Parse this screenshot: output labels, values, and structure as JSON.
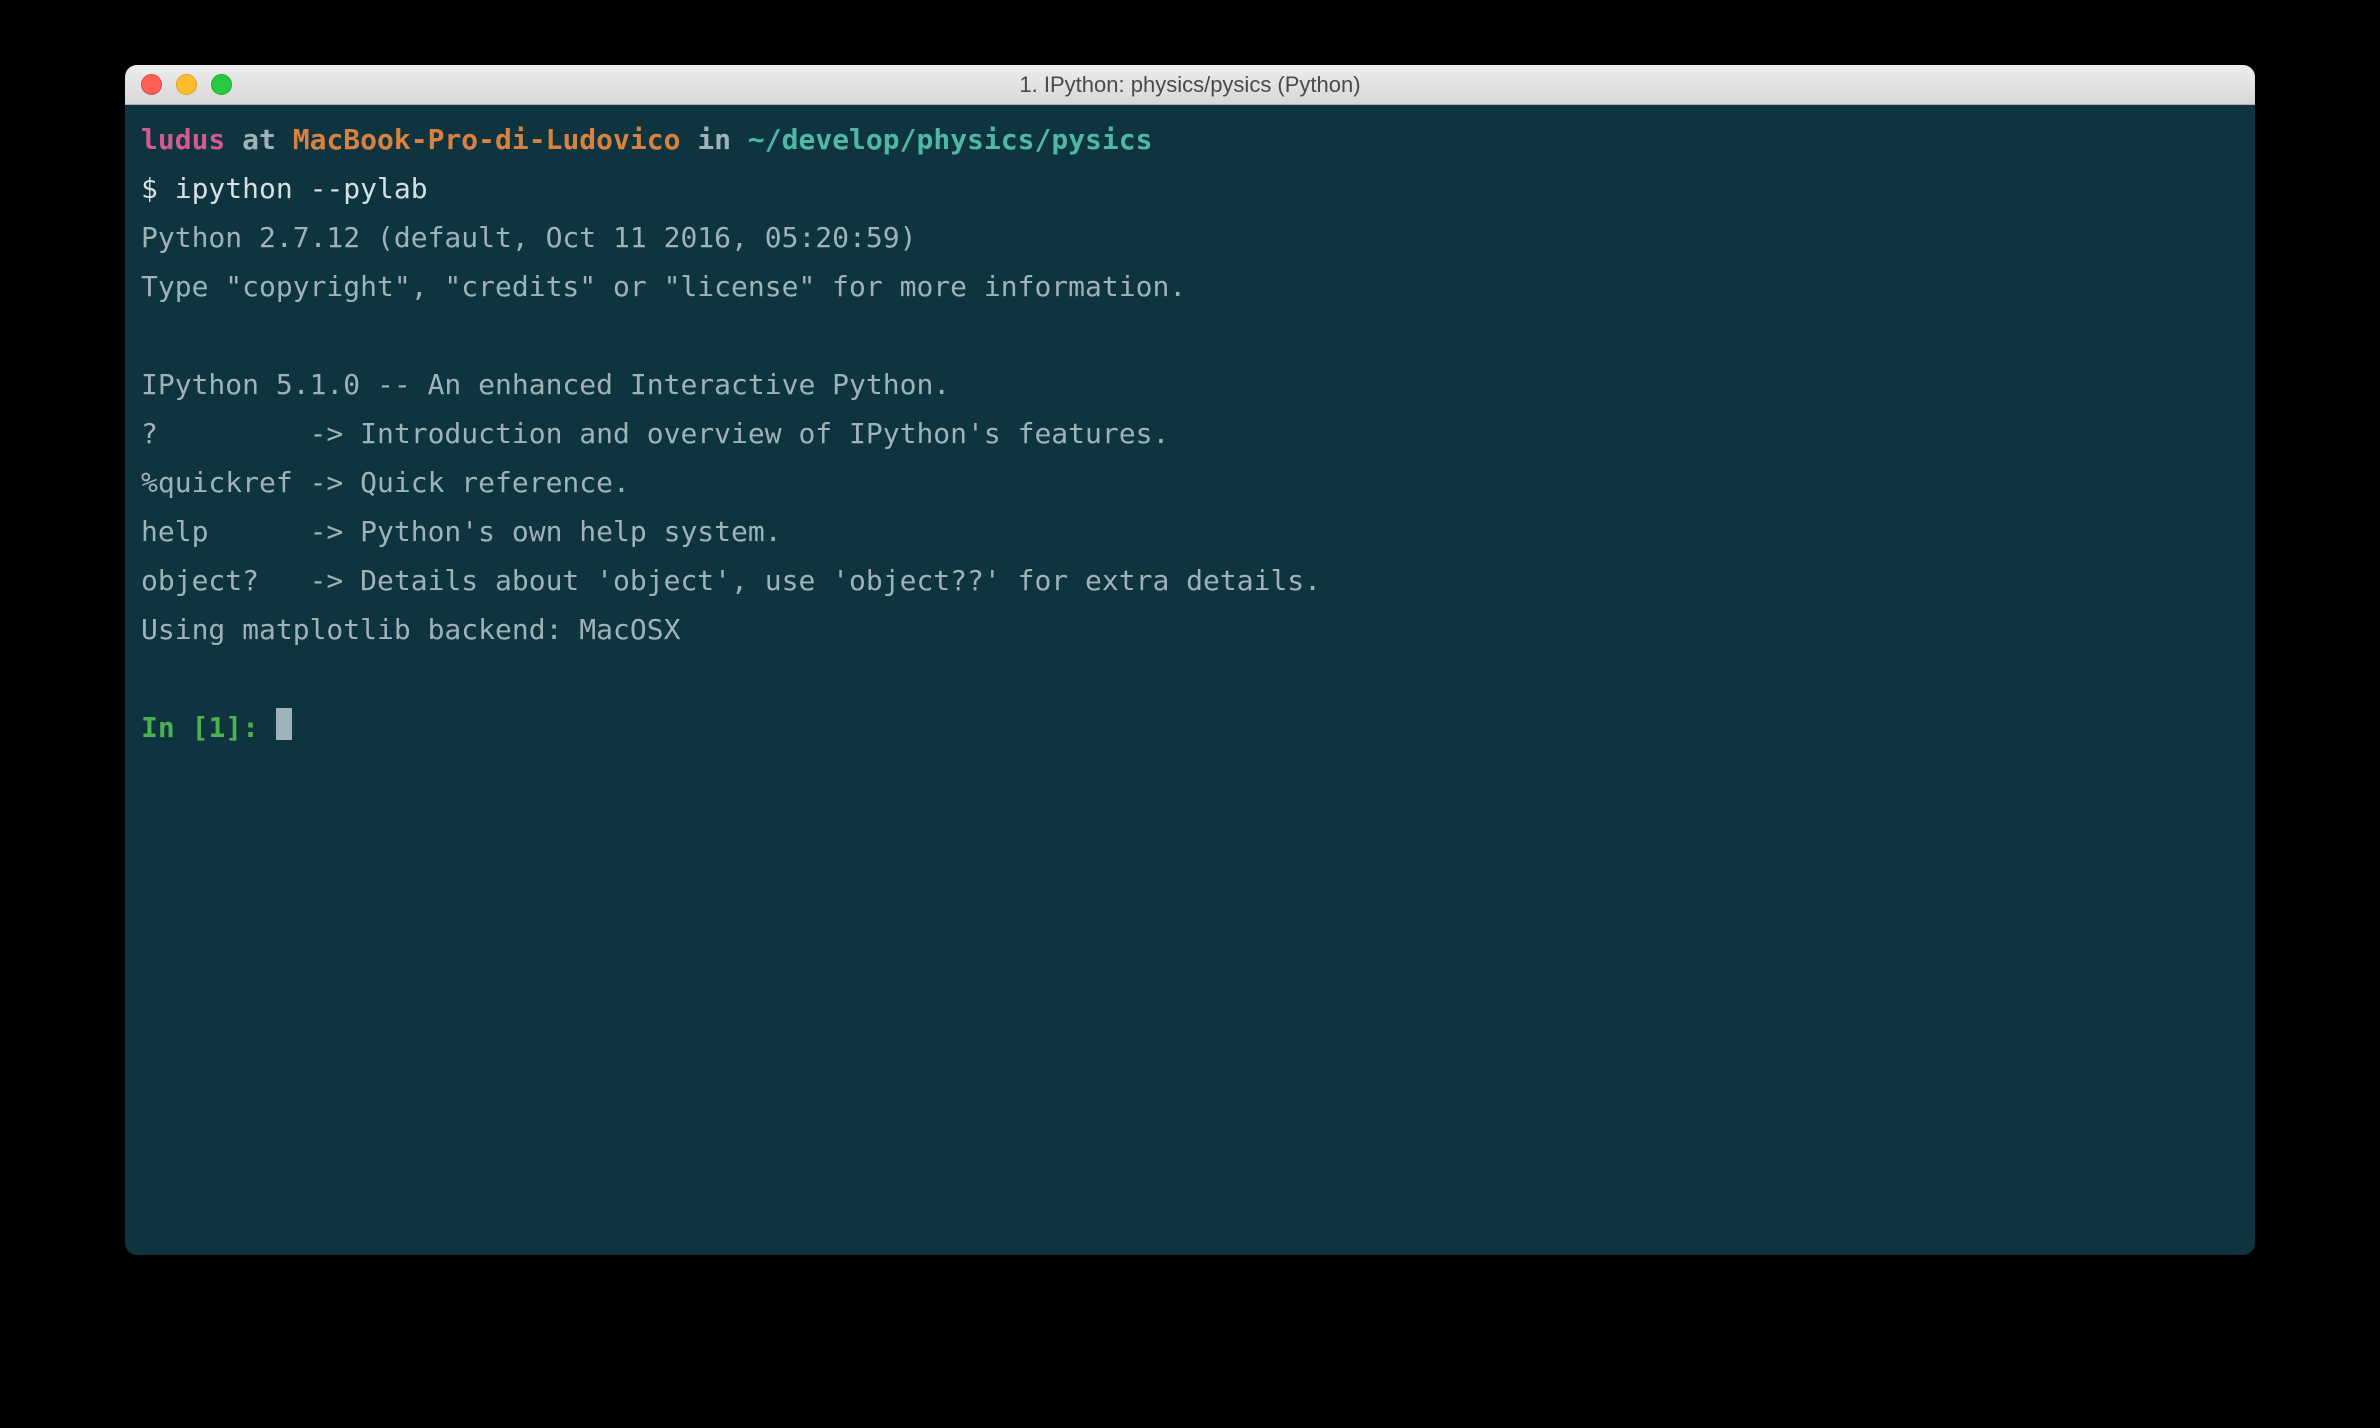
{
  "titlebar": {
    "title": "1. IPython: physics/pysics (Python)"
  },
  "prompt": {
    "user": "ludus",
    "at": " at ",
    "host": "MacBook-Pro-di-Ludovico",
    "in": " in ",
    "path": "~/develop/physics/pysics",
    "symbol": "$ ",
    "command": "ipython --pylab"
  },
  "output": {
    "line1": "Python 2.7.12 (default, Oct 11 2016, 05:20:59) ",
    "line2": "Type \"copyright\", \"credits\" or \"license\" for more information.",
    "blank1": "",
    "line3": "IPython 5.1.0 -- An enhanced Interactive Python.",
    "line4": "?         -> Introduction and overview of IPython's features.",
    "line5": "%quickref -> Quick reference.",
    "line6": "help      -> Python's own help system.",
    "line7": "object?   -> Details about 'object', use 'object??' for extra details.",
    "line8": "Using matplotlib backend: MacOSX",
    "blank2": ""
  },
  "input_prompt": {
    "label": "In [",
    "number": "1",
    "suffix": "]: "
  }
}
